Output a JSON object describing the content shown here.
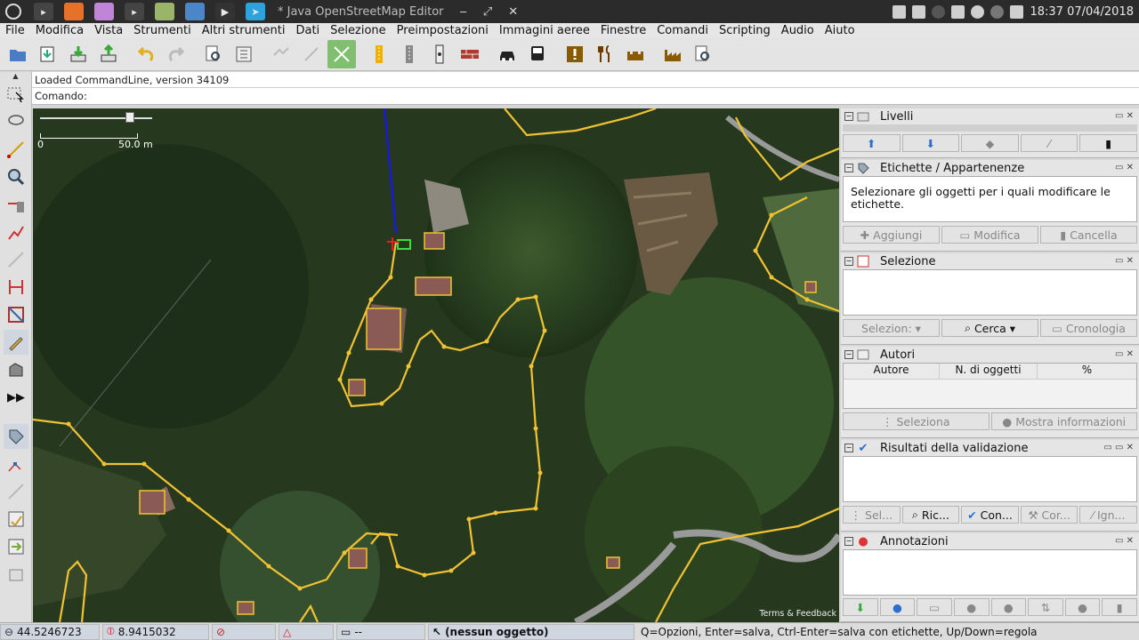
{
  "taskbar": {
    "window_title": "* Java OpenStreetMap Editor",
    "minimize": "‒",
    "maximize": "⤢",
    "close": "✕",
    "clock": "18:37 07/04/2018"
  },
  "menu": [
    "File",
    "Modifica",
    "Vista",
    "Strumenti",
    "Altri strumenti",
    "Dati",
    "Selezione",
    "Preimpostazioni",
    "Immagini aeree",
    "Finestre",
    "Comandi",
    "Scripting",
    "Audio",
    "Aiuto"
  ],
  "infobar": {
    "text": "Loaded CommandLine, version 34109"
  },
  "cmdbar": {
    "text": "Comando:"
  },
  "map": {
    "scale_zero": "0",
    "scale_label": "50.0 m",
    "terms": "Terms & Feedback"
  },
  "panels": {
    "livelli": {
      "title": "Livelli"
    },
    "etichette": {
      "title": "Etichette / Appartenenze",
      "message": "Selezionare gli oggetti per i quali modificare le etichette.",
      "add": "Aggiungi",
      "edit": "Modifica",
      "delete": "Cancella"
    },
    "selezione": {
      "title": "Selezione",
      "select": "Selezion:",
      "search": "Cerca",
      "history": "Cronologia"
    },
    "autori": {
      "title": "Autori",
      "col_author": "Autore",
      "col_count": "N. di oggetti",
      "col_pct": "%",
      "select": "Seleziona",
      "info": "Mostra informazioni"
    },
    "validazione": {
      "title": "Risultati della validazione",
      "sel": "Sel...",
      "ric": "Ric...",
      "con": "Con...",
      "cor": "Cor...",
      "ign": "Ign..."
    },
    "annotazioni": {
      "title": "Annotazioni"
    }
  },
  "status": {
    "lat": "44.5246723",
    "lon": "8.9415032",
    "distance": "--",
    "selection": "(nessun oggetto)",
    "hint": "Q=Opzioni, Enter=salva, Ctrl-Enter=salva con etichette, Up/Down=regola"
  },
  "colors": {
    "way": "#f1c232",
    "selected_way": "#1a1ad6",
    "taskbar": "#2b2b2b",
    "toolbar": "#e4e4e4"
  }
}
